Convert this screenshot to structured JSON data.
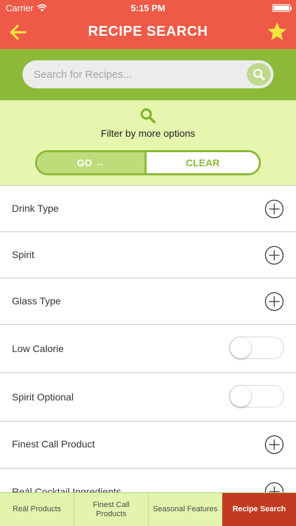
{
  "status_bar": {
    "carrier": "Carrier",
    "time": "5:15 PM"
  },
  "nav": {
    "title": "RECIPE SEARCH"
  },
  "search": {
    "placeholder": "Search for Recipes..."
  },
  "filter": {
    "text": "Filter by more options",
    "go_label": "GO",
    "go_arrow": "→",
    "clear_label": "CLEAR"
  },
  "list": {
    "drink_type": "Drink Type",
    "spirit": "Spirit",
    "glass_type": "Glass Type",
    "low_calorie": "Low Calorie",
    "spirit_optional": "Spirit Optional",
    "finest_call_product": "Finest Call Product",
    "real_cocktail_ingredients": "Reál Cocktail Ingredients"
  },
  "tabs": {
    "real_products": "Reál Products",
    "finest_call_products": "Finest Call Products",
    "seasonal_features": "Seasonal Features",
    "recipe_search": "Recipe Search"
  },
  "colors": {
    "header": "#ee5a47",
    "search_band": "#8cba38",
    "filter_panel": "#e6f6ae",
    "active_tab": "#c23a22",
    "tab_bg": "#e3f5ad"
  }
}
